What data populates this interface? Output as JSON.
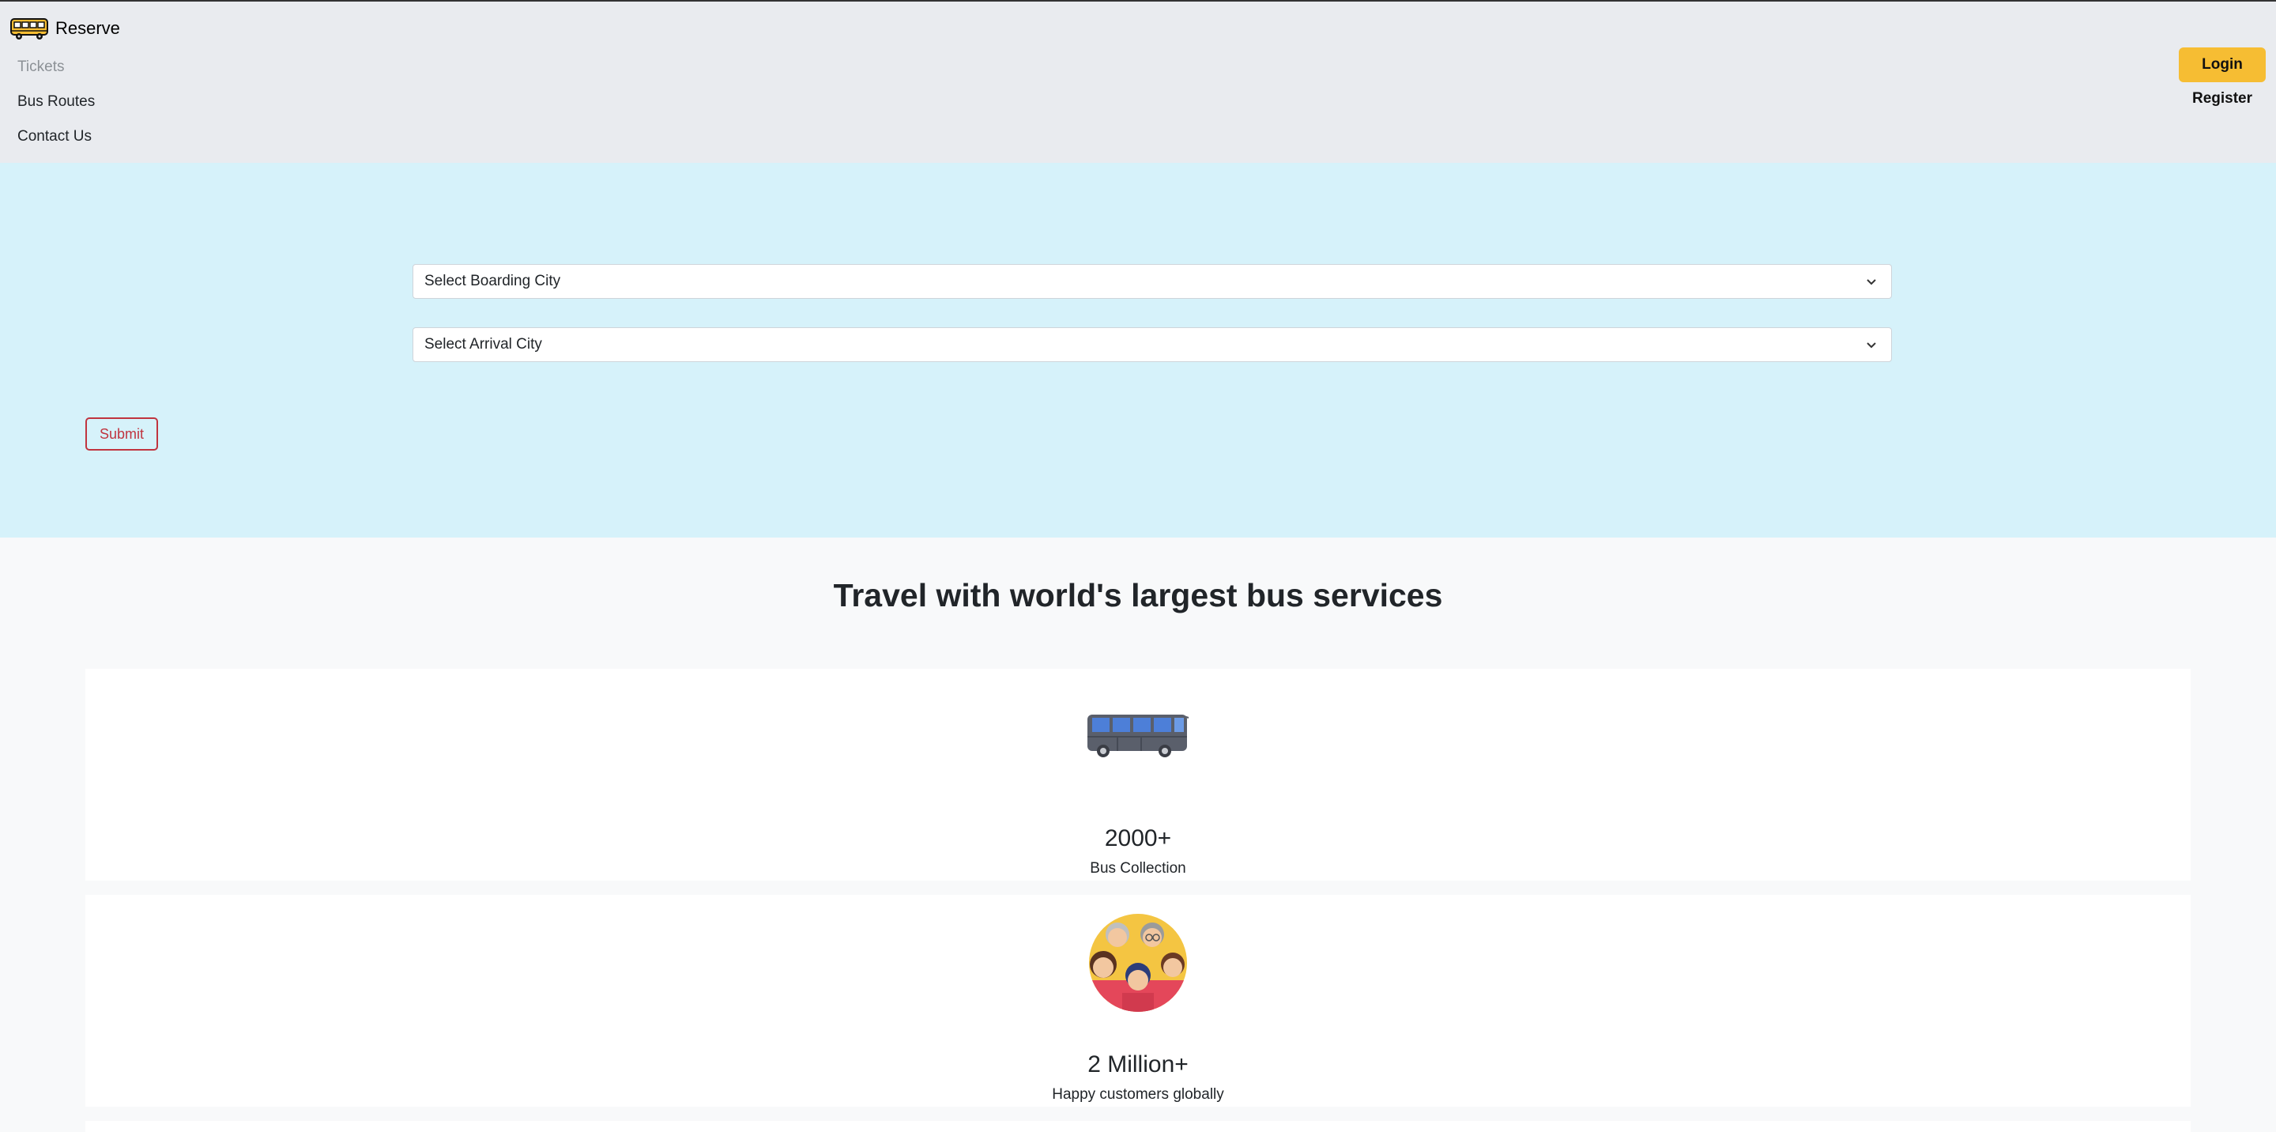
{
  "brand": {
    "name": "Reserve",
    "icon": "bus-icon"
  },
  "nav": {
    "items": [
      {
        "label": "Tickets",
        "state": "disabled"
      },
      {
        "label": "Bus Routes"
      },
      {
        "label": "Contact Us"
      }
    ]
  },
  "auth": {
    "login_label": "Login",
    "register_label": "Register"
  },
  "search": {
    "boarding_placeholder": "Select Boarding City",
    "arrival_placeholder": "Select Arrival City",
    "submit_label": "Submit"
  },
  "stats": {
    "title": "Travel with world's largest bus services",
    "cards": [
      {
        "value": "2000+",
        "label": "Bus Collection",
        "icon": "bus-icon"
      },
      {
        "value": "2 Million+",
        "label": "Happy customers globally",
        "icon": "customers-icon"
      }
    ]
  },
  "colors": {
    "header_bg": "#e9ebef",
    "search_bg": "#d6f2fa",
    "accent_yellow": "#f6bd33",
    "submit_red": "#c0343f",
    "page_bg": "#f8f9fa"
  }
}
